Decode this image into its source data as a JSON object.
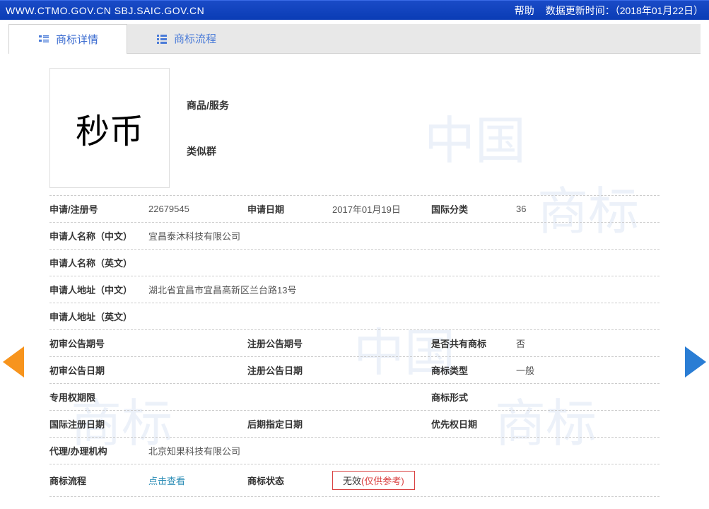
{
  "banner": {
    "url": "WWW.CTMO.GOV.CN SBJ.SAIC.GOV.CN",
    "help": "帮助",
    "update_label": "数据更新时间：",
    "update_date": "（2018年01月22日）"
  },
  "tabs": {
    "details": "商标详情",
    "process": "商标流程"
  },
  "logo_text": "秒币",
  "header": {
    "goods_label": "商品/服务",
    "group_label": "类似群"
  },
  "rows": {
    "reg_no_label": "申请/注册号",
    "reg_no_value": "22679545",
    "app_date_label": "申请日期",
    "app_date_value": "2017年01月19日",
    "intl_class_label": "国际分类",
    "intl_class_value": "36",
    "applicant_cn_label": "申请人名称（中文）",
    "applicant_cn_value": "宜昌泰沐科技有限公司",
    "applicant_en_label": "申请人名称（英文）",
    "applicant_en_value": "",
    "address_cn_label": "申请人地址（中文）",
    "address_cn_value": "湖北省宜昌市宜昌高新区兰台路13号",
    "address_en_label": "申请人地址（英文）",
    "address_en_value": "",
    "prelim_no_label": "初审公告期号",
    "prelim_no_value": "",
    "reg_notice_no_label": "注册公告期号",
    "reg_notice_no_value": "",
    "joint_label": "是否共有商标",
    "joint_value": "否",
    "prelim_date_label": "初审公告日期",
    "prelim_date_value": "",
    "reg_notice_date_label": "注册公告日期",
    "reg_notice_date_value": "",
    "tm_type_label": "商标类型",
    "tm_type_value": "一般",
    "exclusive_label": "专用权期限",
    "exclusive_value": "",
    "tm_form_label": "商标形式",
    "tm_form_value": "",
    "intl_reg_date_label": "国际注册日期",
    "intl_reg_date_value": "",
    "late_date_label": "后期指定日期",
    "late_date_value": "",
    "priority_date_label": "优先权日期",
    "priority_date_value": "",
    "agent_label": "代理/办理机构",
    "agent_value": "北京知果科技有限公司",
    "process_label": "商标流程",
    "process_link": "点击查看",
    "status_label": "商标状态",
    "status_value": "无效",
    "status_note": "(仅供参考)"
  }
}
